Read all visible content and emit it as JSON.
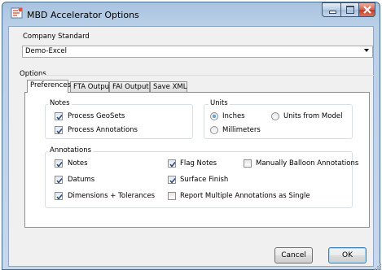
{
  "window": {
    "title": "MBD Accelerator Options"
  },
  "company_standard": {
    "label": "Company Standard",
    "selected": "Demo-Excel"
  },
  "options": {
    "label": "Options",
    "tabs": [
      {
        "label": "Preferences",
        "active": true
      },
      {
        "label": "FTA Output",
        "active": false
      },
      {
        "label": "FAI Output",
        "active": false
      },
      {
        "label": "Save XML",
        "active": false
      }
    ]
  },
  "notes_group": {
    "title": "Notes",
    "process_geosets": {
      "label": "Process GeoSets",
      "checked": true
    },
    "process_annotations": {
      "label": "Process Annotations",
      "checked": true
    }
  },
  "units_group": {
    "title": "Units",
    "inches": {
      "label": "Inches",
      "selected": true
    },
    "units_from_model": {
      "label": "Units from Model",
      "selected": false
    },
    "millimeters": {
      "label": "Millimeters",
      "selected": false
    }
  },
  "annotations_group": {
    "title": "Annotations",
    "notes": {
      "label": "Notes",
      "checked": true
    },
    "datums": {
      "label": "Datums",
      "checked": true
    },
    "dimensions": {
      "label": "Dimensions + Tolerances",
      "checked": true
    },
    "flag_notes": {
      "label": "Flag Notes",
      "checked": true
    },
    "surface_finish": {
      "label": "Surface Finish",
      "checked": true
    },
    "report_multiple": {
      "label": "Report Multiple Annotations as Single",
      "checked": false
    },
    "manually_balloon": {
      "label": "Manually Balloon Annotations",
      "checked": false
    }
  },
  "buttons": {
    "cancel": "Cancel",
    "ok": "OK"
  },
  "colors": {
    "frame": "#bad0e8",
    "client": "#f0f0f0",
    "close": "#c23a23",
    "check": "#2d4a7a"
  },
  "icons": [
    "app-icon",
    "minimize-icon",
    "maximize-icon",
    "close-icon",
    "dropdown-arrow-icon",
    "checkmark-icon",
    "size-grip-icon"
  ]
}
